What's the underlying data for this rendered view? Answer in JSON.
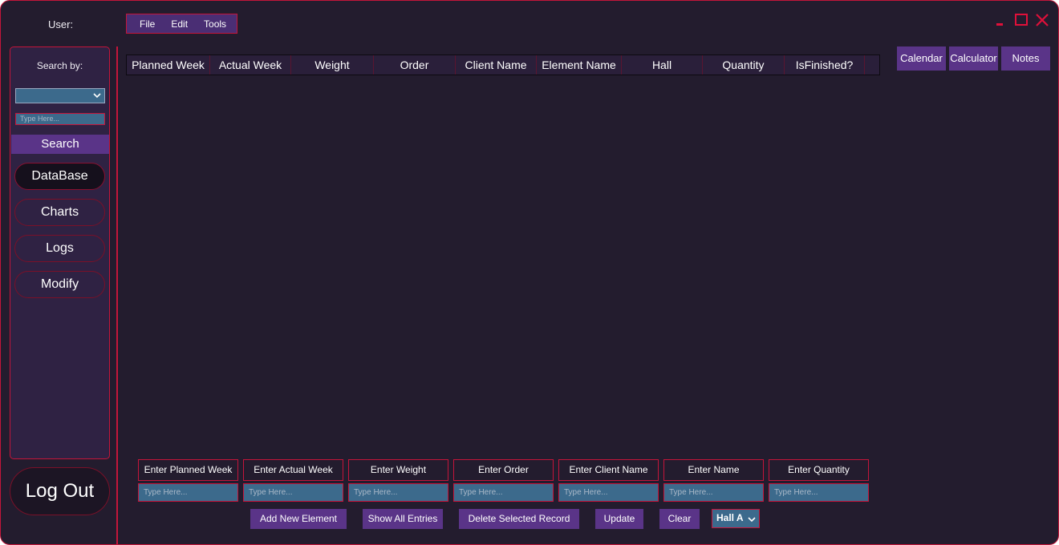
{
  "header": {
    "user_label": "User:",
    "menu": [
      "File",
      "Edit",
      "Tools"
    ]
  },
  "window_controls": [
    "minimize-icon",
    "maximize-icon",
    "close-icon"
  ],
  "sidebar": {
    "search_by_label": "Search by:",
    "search_select_value": "",
    "search_placeholder": "Type Here...",
    "search_button": "Search",
    "nav": [
      {
        "label": "DataBase",
        "active": true
      },
      {
        "label": "Charts",
        "active": false
      },
      {
        "label": "Logs",
        "active": false
      },
      {
        "label": "Modify",
        "active": false
      }
    ],
    "logout": "Log Out"
  },
  "table": {
    "columns": [
      "Planned Week",
      "Actual Week",
      "Weight",
      "Order",
      "Client Name",
      "Element Name",
      "Hall",
      "Quantity",
      "IsFinished?"
    ],
    "rows": []
  },
  "right_buttons": [
    "Calendar",
    "Calculator",
    "Notes"
  ],
  "form": {
    "fields": [
      {
        "label": "Enter Planned Week",
        "placeholder": "Type Here..."
      },
      {
        "label": "Enter Actual Week",
        "placeholder": "Type Here..."
      },
      {
        "label": "Enter Weight",
        "placeholder": "Type Here..."
      },
      {
        "label": "Enter Order",
        "placeholder": "Type Here..."
      },
      {
        "label": "Enter Client Name",
        "placeholder": "Type Here..."
      },
      {
        "label": "Enter Name",
        "placeholder": "Type Here..."
      },
      {
        "label": "Enter Quantity",
        "placeholder": "Type Here..."
      }
    ],
    "actions": [
      "Add New Element",
      "Show All Entries",
      "Delete Selected Record",
      "Update",
      "Clear"
    ],
    "hall_select_value": "Hall A"
  },
  "colors": {
    "background": "#231c2e",
    "accent_border": "#c4153a",
    "button_purple": "#5a3488",
    "input_blue": "#3c6a8c"
  }
}
